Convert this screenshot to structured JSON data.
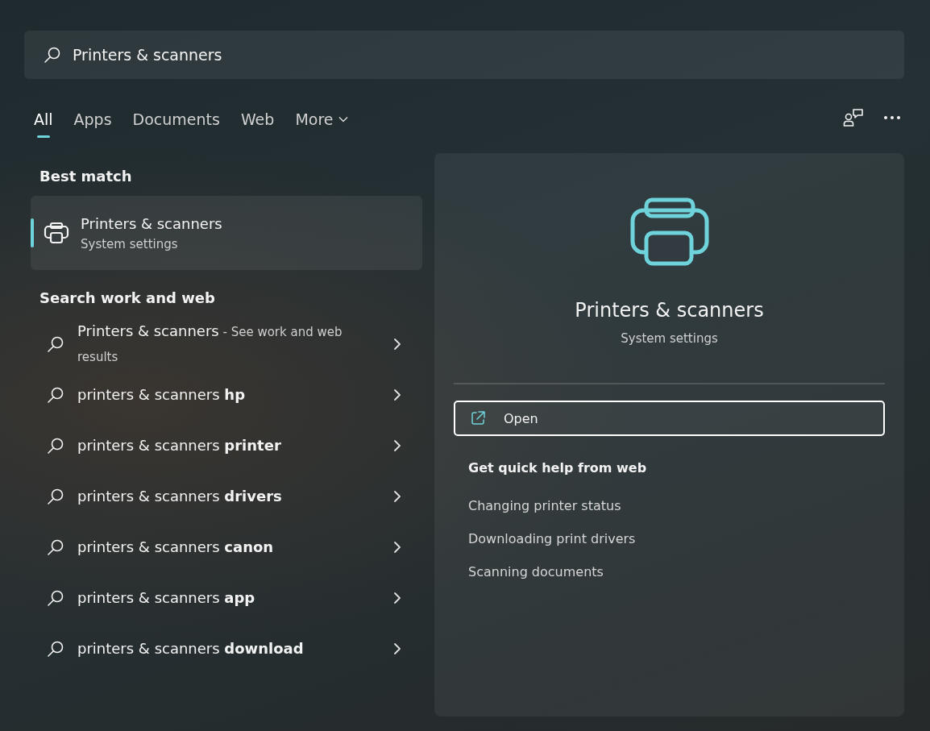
{
  "search": {
    "value": "Printers & scanners"
  },
  "tabs": [
    {
      "label": "All",
      "selected": true,
      "kind": "plain"
    },
    {
      "label": "Apps",
      "selected": false,
      "kind": "plain"
    },
    {
      "label": "Documents",
      "selected": false,
      "kind": "plain"
    },
    {
      "label": "Web",
      "selected": false,
      "kind": "plain"
    },
    {
      "label": "More",
      "selected": false,
      "kind": "dropdown"
    }
  ],
  "best_match": {
    "heading": "Best match",
    "item": {
      "title": "Printers & scanners",
      "subtitle": "System settings",
      "selected": true
    }
  },
  "web_search": {
    "heading": "Search work and web",
    "items": [
      {
        "text": "Printers & scanners",
        "suffix": " - See work and web results"
      },
      {
        "text": "printers & scanners **hp**"
      },
      {
        "text": "printers & scanners **printer**"
      },
      {
        "text": "printers & scanners **drivers**"
      },
      {
        "text": "printers & scanners **canon**"
      },
      {
        "text": "printers & scanners **app**"
      },
      {
        "text": "printers & scanners **download**"
      }
    ]
  },
  "preview": {
    "title": "Printers & scanners",
    "subtitle": "System settings",
    "actions": [
      {
        "label": "Open",
        "focused": true
      }
    ],
    "help_heading": "Get quick help from web",
    "help_links": [
      "Changing printer status",
      "Downloading print drivers",
      "Scanning documents"
    ]
  }
}
